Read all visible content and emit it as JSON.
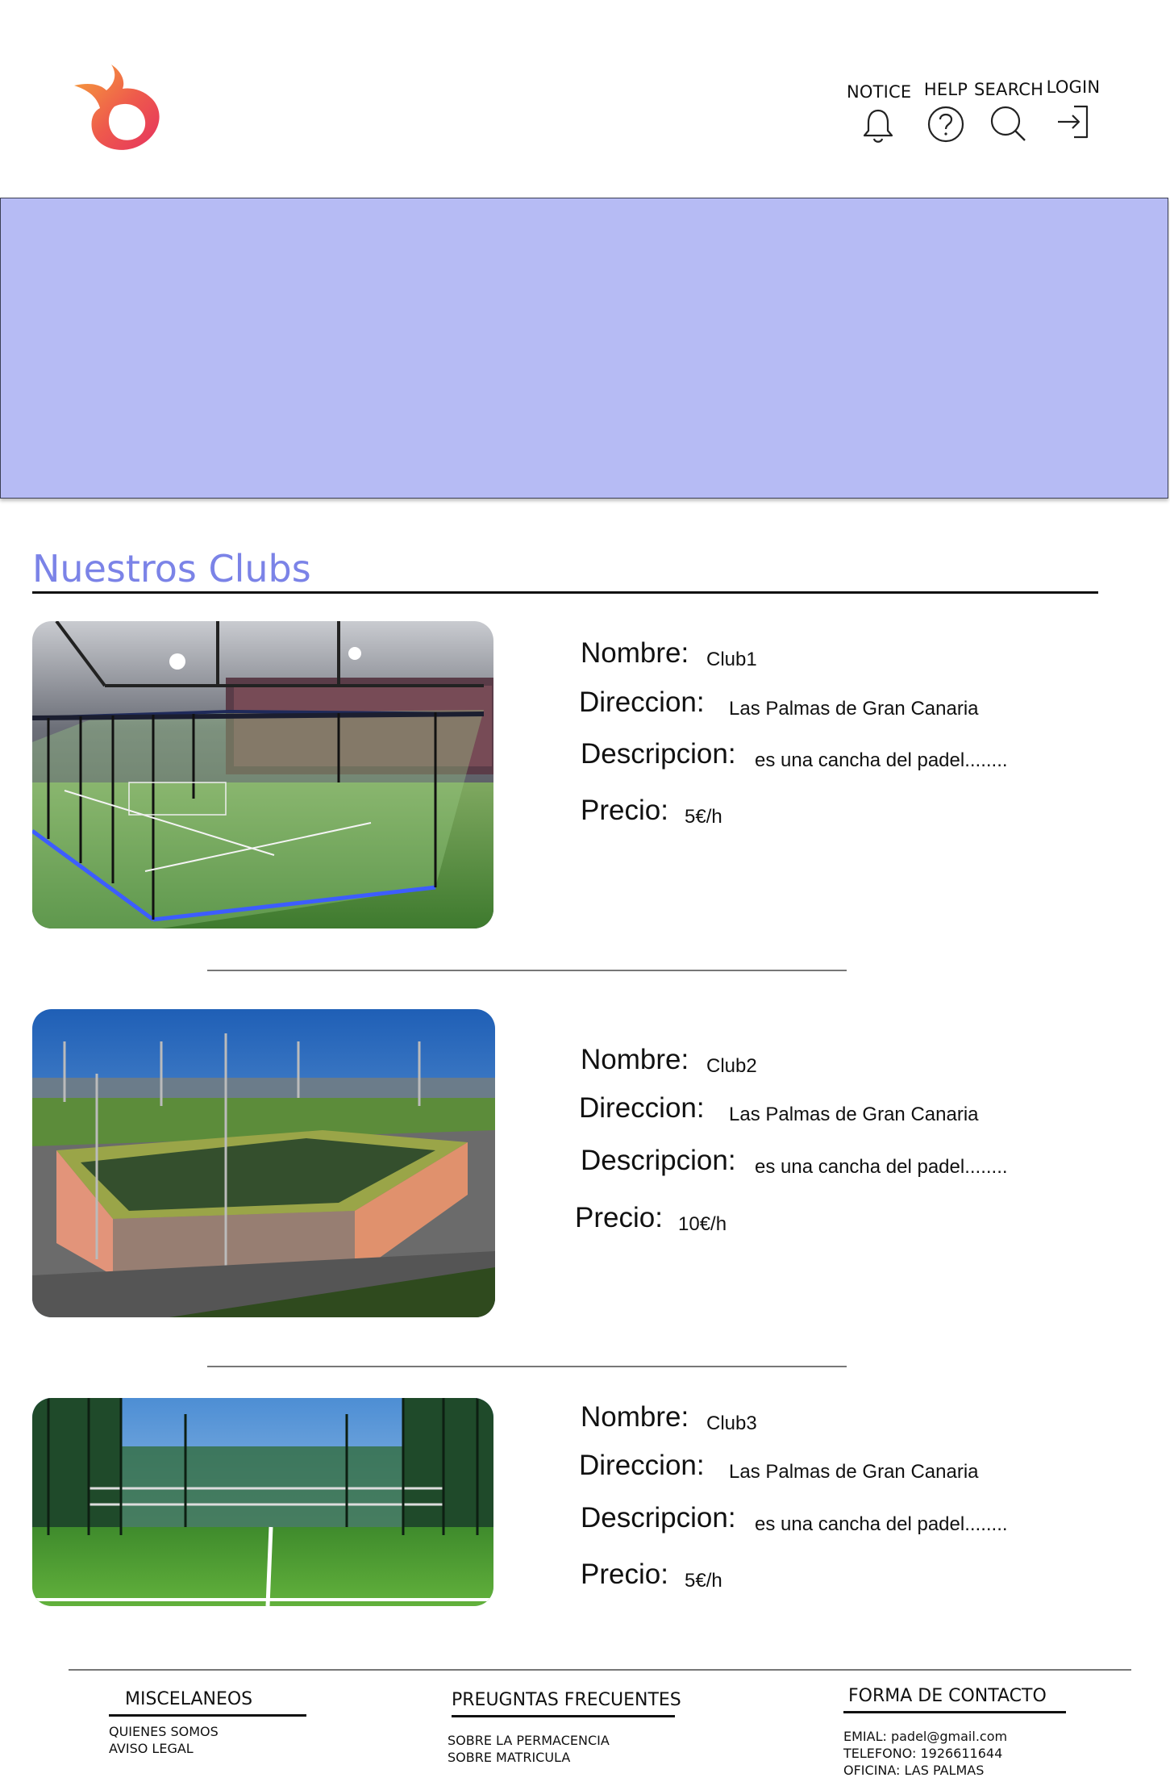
{
  "header": {
    "nav": [
      {
        "label": "NOTICE",
        "icon": "bell-icon"
      },
      {
        "label": "HELP",
        "icon": "help-circle-icon"
      },
      {
        "label": "SEARCH",
        "icon": "search-icon"
      },
      {
        "label": "LOGIN",
        "icon": "login-icon"
      }
    ]
  },
  "main": {
    "section_title": "Nuestros Clubs",
    "labels": {
      "nombre": "Nombre:",
      "direccion": "Direccion:",
      "descripcion": "Descripcion:",
      "precio": "Precio:"
    },
    "clubs": [
      {
        "nombre": "Club1",
        "direccion": "Las Palmas de Gran Canaria",
        "descripcion": "es una cancha del padel........",
        "precio": "5€/h"
      },
      {
        "nombre": "Club2",
        "direccion": "Las Palmas de Gran Canaria",
        "descripcion": "es una cancha del padel........",
        "precio": "10€/h"
      },
      {
        "nombre": "Club3",
        "direccion": "Las Palmas de Gran Canaria",
        "descripcion": "es una cancha del padel........",
        "precio": "5€/h"
      }
    ]
  },
  "footer": {
    "miscelaneos": {
      "title": "MISCELANEOS",
      "links": [
        "QUIENES SOMOS",
        "AVISO LEGAL"
      ]
    },
    "faq": {
      "title": "PREUGNTAS FRECUENTES",
      "links": [
        "SOBRE LA PERMACENCIA",
        "SOBRE MATRICULA"
      ]
    },
    "contacto": {
      "title": "FORMA DE CONTACTO",
      "lines": [
        "EMIAL: padel@gmail.com",
        "TELEFONO: 1926611644",
        "OFICINA: LAS PALMAS"
      ]
    }
  },
  "colors": {
    "accent": "#7b83e7",
    "banner": "#b6bbf4",
    "logo_start": "#f6a33a",
    "logo_end": "#e6335f"
  }
}
